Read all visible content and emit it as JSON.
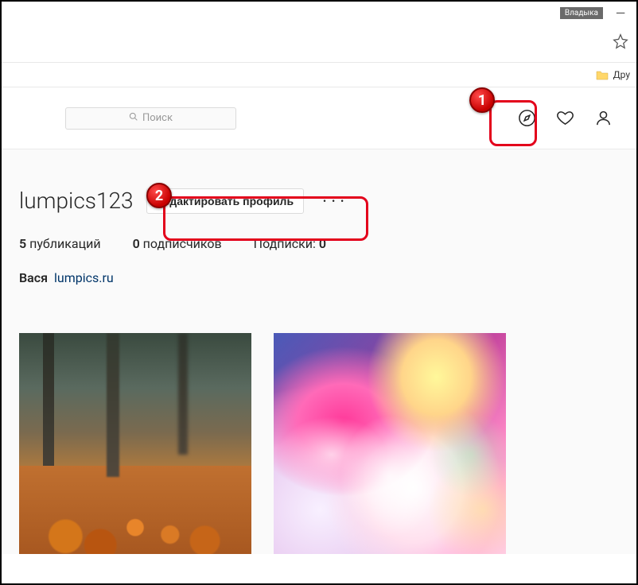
{
  "window": {
    "user_tag": "Владыка"
  },
  "bookmarks": {
    "other_label": "Дру"
  },
  "header": {
    "search_placeholder": "Поиск",
    "icons": {
      "explore": "explore-icon",
      "activity": "heart-icon",
      "profile": "user-icon"
    }
  },
  "profile": {
    "username": "lumpics123",
    "edit_label": "Редактировать профиль",
    "stats": {
      "posts_count": "5",
      "posts_label": "публикаций",
      "followers_count": "0",
      "followers_label": "подписчиков",
      "following_label": "Подписки:",
      "following_count": "0"
    },
    "display_name": "Вася",
    "bio_link": "lumpics.ru"
  },
  "annotations": {
    "step1": "1",
    "step2": "2"
  }
}
